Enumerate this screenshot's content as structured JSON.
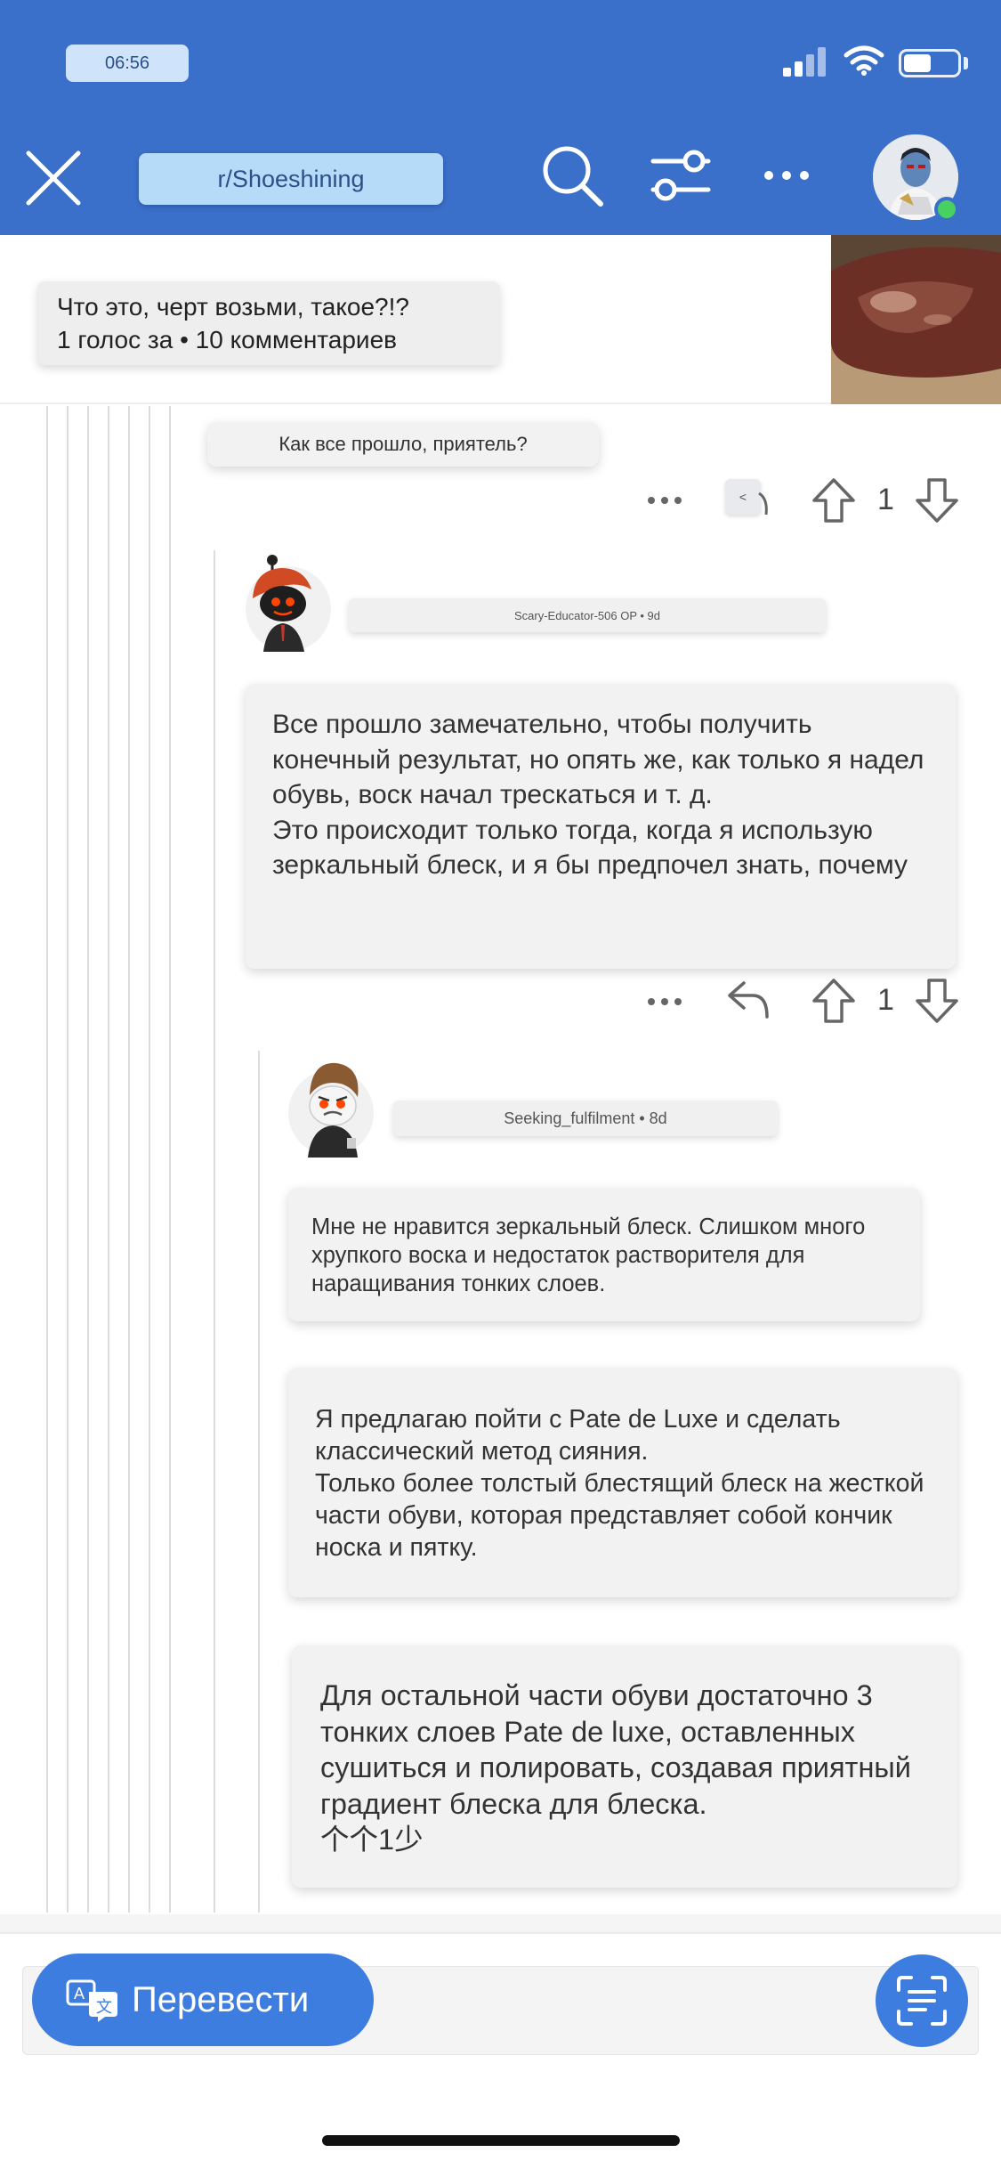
{
  "status_bar": {
    "time": "06:56"
  },
  "header": {
    "subreddit": "r/Shoeshining"
  },
  "post": {
    "title": "Что это, черт возьми, такое?!?",
    "stats": "1 голос за • 10 комментариев"
  },
  "comments": [
    {
      "text": "Как все прошло, приятель?",
      "votes": "1",
      "reply_label": "<"
    },
    {
      "meta": "Scary-Educator-506 OP • 9d",
      "text": "Все прошло замечательно, чтобы получить конечный результат, но опять же, как только я надел обувь, воск начал трескаться и т. д.\nЭто происходит только тогда, когда я использую зеркальный блеск, и я бы предпочел знать, почему",
      "votes": "1"
    },
    {
      "meta": "Seeking_fulfilment • 8d",
      "paragraphs": [
        "Мне не нравится зеркальный блеск. Слишком много хрупкого воска и недостаток растворителя для наращивания тонких слоев.",
        "Я предлагаю пойти с Pate de Luxe и сделать классический метод сияния.\nТолько более толстый блестящий блеск на жесткой части обуви, которая представляет собой кончик носка и пятку.",
        "Для остальной части обуви достаточно 3 тонких слоев Pate de luxe, оставленных сушиться и полировать, создавая приятный градиент блеска для блеска.\n个个1少"
      ]
    }
  ],
  "bottom": {
    "translate_label": "Перевести"
  },
  "colors": {
    "header": "#3a6fca",
    "accent": "#3e7de0",
    "online": "#46d160"
  }
}
